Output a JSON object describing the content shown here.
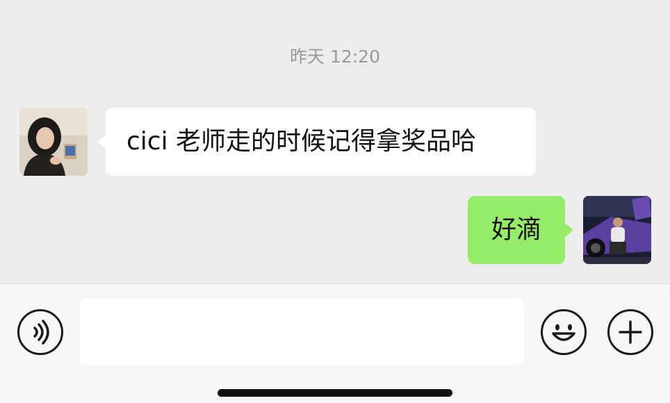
{
  "chat": {
    "timestamp": "昨天 12:20",
    "messages": [
      {
        "sender": "other",
        "text": "cici 老师走的时候记得拿奖品哈"
      },
      {
        "sender": "self",
        "text": "好滴"
      }
    ]
  },
  "input_bar": {
    "text_value": "",
    "icons": [
      "voice-icon",
      "emoji-icon",
      "plus-icon"
    ]
  },
  "colors": {
    "background": "#ededed",
    "self_bubble": "#95ec69",
    "other_bubble": "#ffffff"
  }
}
